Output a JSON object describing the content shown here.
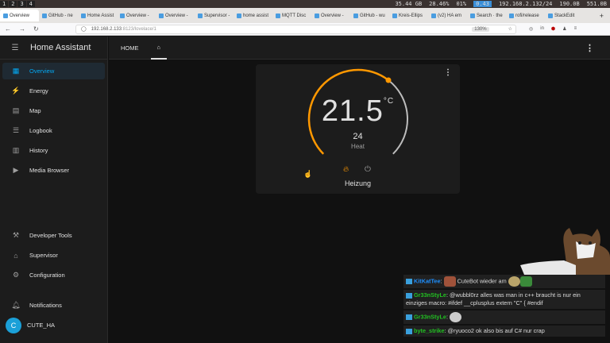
{
  "system_bar": {
    "workspaces": [
      "1",
      "2",
      "3",
      "4"
    ],
    "stats": [
      "35.44 GB",
      "28.46%",
      "01%",
      "0.43",
      "192.168.2.132/24",
      "190.0B",
      "551.0B"
    ]
  },
  "browser": {
    "tabs": [
      "Overview",
      "GitHub - ne",
      "Home Assist",
      "Overview -",
      "Overview -",
      "Supervisor -",
      "home assist",
      "MQTT Disc",
      "Overview -",
      "GitHub - wu",
      "Kreis-Ellips",
      "(v2) HA em",
      "Search · the",
      "rofi/release",
      "StackEdit"
    ],
    "new_tab": "+",
    "url_host": "192.168.2.133",
    "url_rest": ":8123/lovelace/1",
    "zoom": "130%"
  },
  "sidebar": {
    "title": "Home Assistant",
    "items": [
      {
        "label": "Overview",
        "icon": "dashboard-icon"
      },
      {
        "label": "Energy",
        "icon": "lightning-icon"
      },
      {
        "label": "Map",
        "icon": "map-icon"
      },
      {
        "label": "Logbook",
        "icon": "list-icon"
      },
      {
        "label": "History",
        "icon": "chart-icon"
      },
      {
        "label": "Media Browser",
        "icon": "play-icon"
      }
    ],
    "bottom": [
      {
        "label": "Developer Tools",
        "icon": "hammer-icon"
      },
      {
        "label": "Supervisor",
        "icon": "home-assistant-icon"
      },
      {
        "label": "Configuration",
        "icon": "gear-icon"
      },
      {
        "label": "Notifications",
        "icon": "bell-icon"
      }
    ],
    "user": {
      "initial": "C",
      "name": "CUTE_HA"
    }
  },
  "topbar": {
    "tab_home": "HOME"
  },
  "thermostat": {
    "current": "21.5",
    "unit": "°C",
    "target": "24",
    "mode": "Heat",
    "name": "Heizung",
    "arc_fill": 0.64,
    "accent": "#ff9800"
  },
  "chat": [
    {
      "user": "KitKatTee",
      "color": "#1e90ff",
      "text": "CuteBot wieder am"
    },
    {
      "user": "Gr33nStyLe",
      "color": "#22c022",
      "text": "@wubbl0rz alles was man in c++ braucht is nur ein einziges macro: #ifdef __cplusplus extern \"C\" { #endif"
    },
    {
      "user": "Gr33nStyLe",
      "color": "#22c022",
      "text": ""
    },
    {
      "user": "byte_strike",
      "color": "#22c022",
      "text": "@ryuoco2 ok also bis auf C# nur crap"
    }
  ]
}
